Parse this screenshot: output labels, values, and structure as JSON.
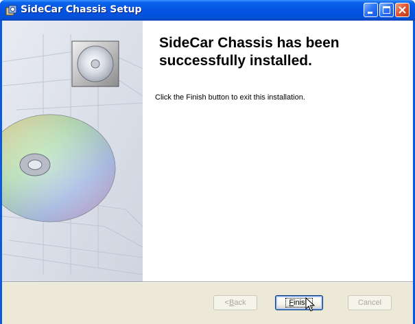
{
  "window": {
    "title": "SideCar Chassis Setup",
    "title_icon": "installer-package-icon",
    "controls": [
      "minimize-icon",
      "maximize-icon",
      "close-icon"
    ]
  },
  "content": {
    "heading": "SideCar Chassis has been successfully installed.",
    "message": "Click the Finish button to exit this installation."
  },
  "buttons": {
    "back": {
      "label_prefix": "< ",
      "mnemonic": "B",
      "label_rest": "ack",
      "enabled": false
    },
    "finish": {
      "mnemonic": "F",
      "label_rest": "inish",
      "enabled": true,
      "default": true
    },
    "cancel": {
      "label": "Cancel",
      "enabled": false
    }
  },
  "colors": {
    "titlebar": "#0553e4",
    "close_button": "#e0522e",
    "footer": "#ece9d8"
  }
}
